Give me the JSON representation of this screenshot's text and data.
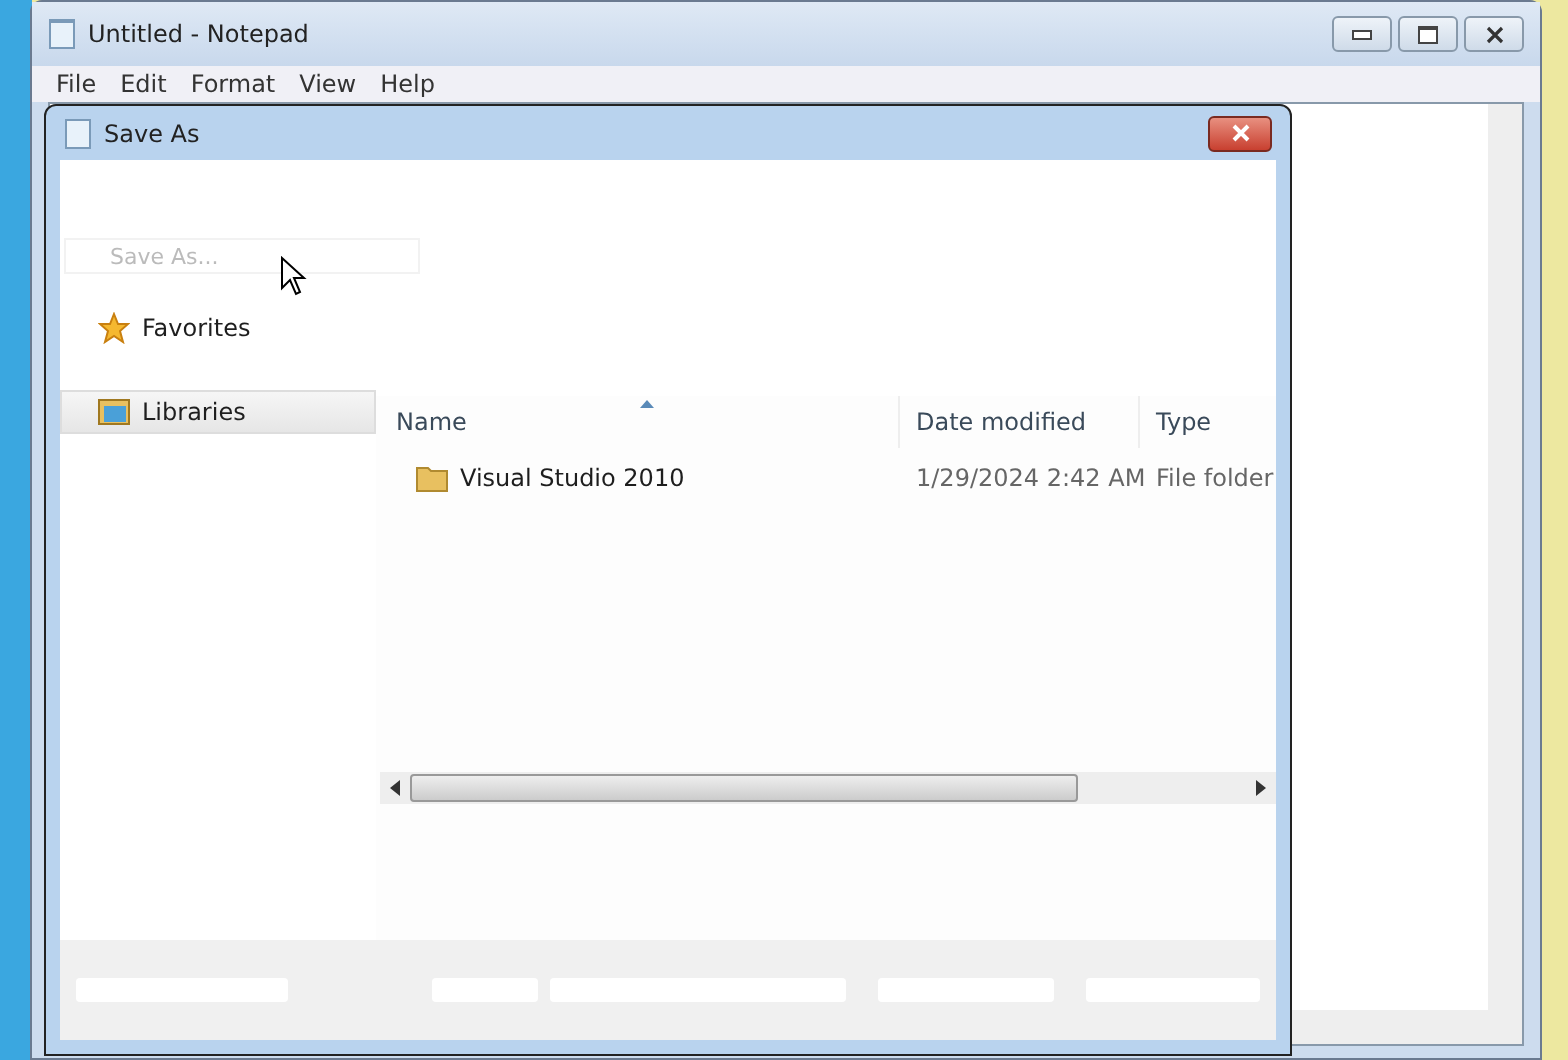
{
  "window": {
    "title": "Untitled - Notepad"
  },
  "menu": [
    "File",
    "Edit",
    "Format",
    "View",
    "Help"
  ],
  "dialog": {
    "title": "Save As",
    "search": {
      "placeholder": "Save As..."
    },
    "nav": [
      {
        "label": "Favorites",
        "kind": "star",
        "selected": false
      },
      {
        "label": "Libraries",
        "kind": "library",
        "selected": true
      }
    ],
    "columns": [
      {
        "label": "Name",
        "sorted": true
      },
      {
        "label": "Date modified",
        "sorted": false
      },
      {
        "label": "Type",
        "sorted": false
      }
    ],
    "rows": [
      {
        "name": "Visual Studio 2010",
        "date": "1/29/2024 2:42 AM",
        "type": "File folder"
      }
    ]
  }
}
